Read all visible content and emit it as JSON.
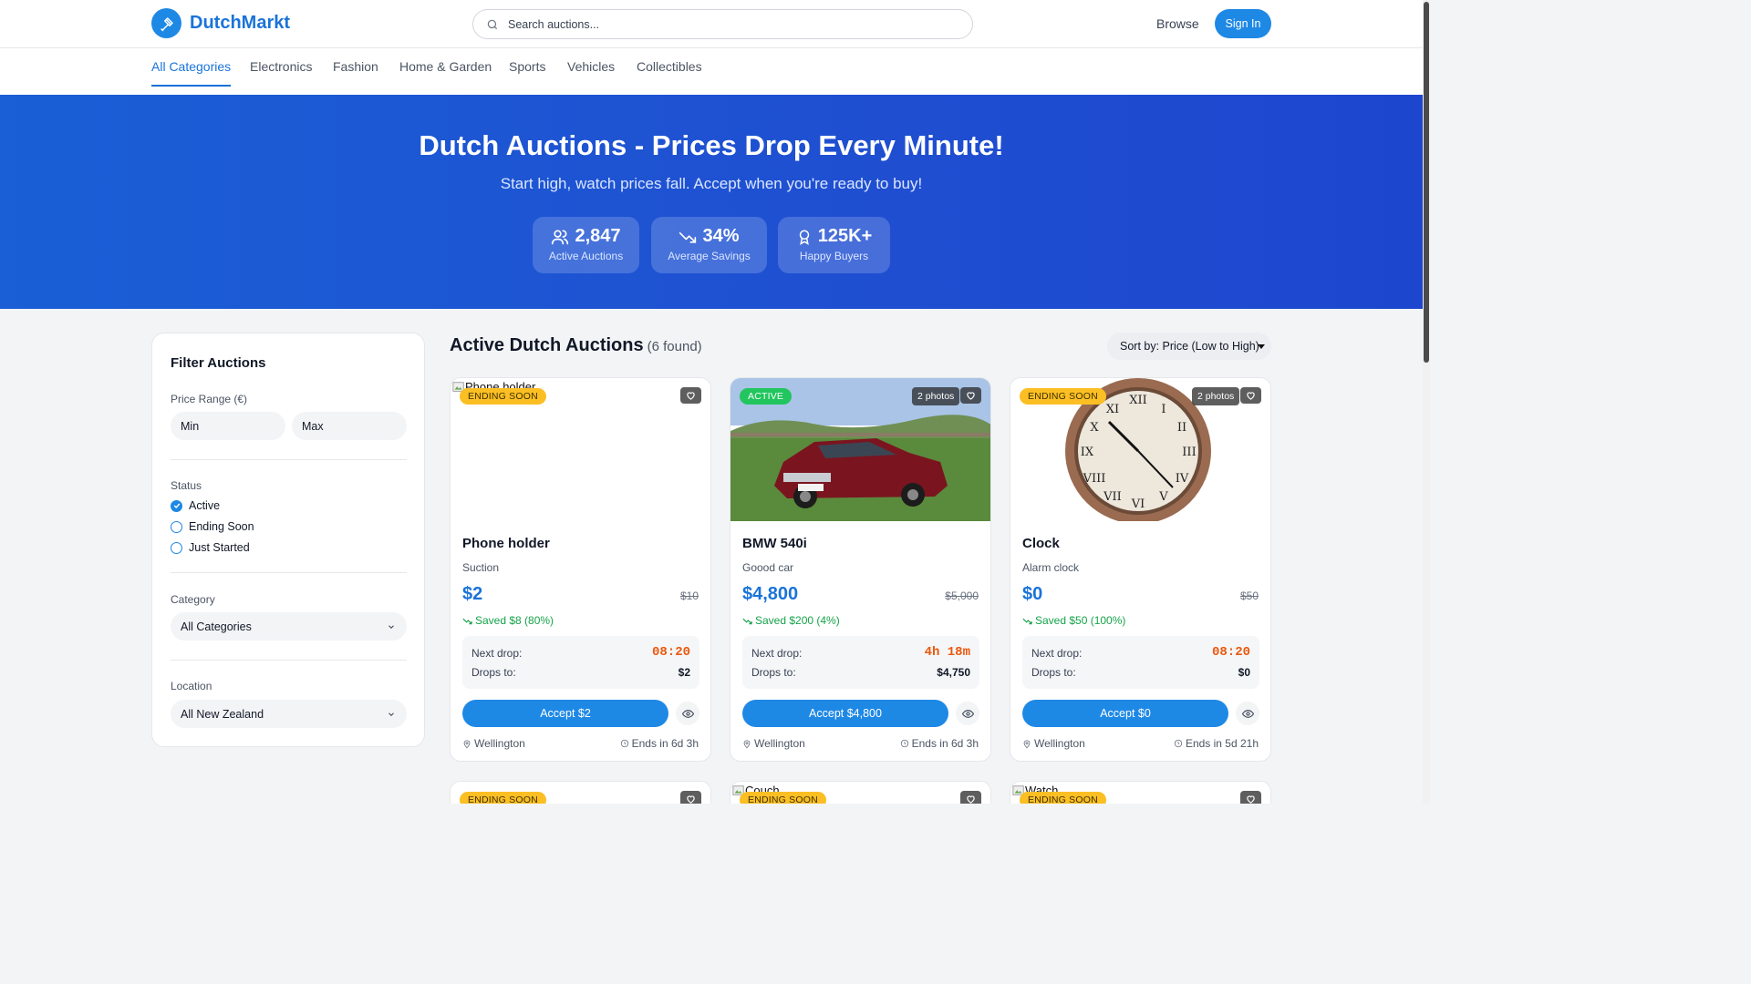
{
  "header": {
    "brand": "DutchMarkt",
    "search_placeholder": "Search auctions...",
    "browse": "Browse",
    "sign_in": "Sign In"
  },
  "categories": [
    "All Categories",
    "Electronics",
    "Fashion",
    "Home & Garden",
    "Sports",
    "Vehicles",
    "Collectibles"
  ],
  "hero": {
    "title": "Dutch Auctions - Prices Drop Every Minute!",
    "subtitle": "Start high, watch prices fall. Accept when you're ready to buy!",
    "stats": [
      {
        "value": "2,847",
        "label": "Active Auctions",
        "icon": "users-icon"
      },
      {
        "value": "34%",
        "label": "Average Savings",
        "icon": "trending-down-icon"
      },
      {
        "value": "125K+",
        "label": "Happy Buyers",
        "icon": "award-icon"
      }
    ]
  },
  "filters": {
    "title": "Filter Auctions",
    "price_label": "Price Range (€)",
    "min_placeholder": "Min",
    "max_placeholder": "Max",
    "status_label": "Status",
    "status_options": [
      {
        "label": "Active",
        "checked": true
      },
      {
        "label": "Ending Soon",
        "checked": false
      },
      {
        "label": "Just Started",
        "checked": false
      }
    ],
    "category_label": "Category",
    "category_value": "All Categories",
    "location_label": "Location",
    "location_value": "All New Zealand"
  },
  "listing": {
    "heading": "Active Dutch Auctions",
    "count": "(6 found)",
    "sort": "Sort by: Price (Low to High)"
  },
  "auctions": [
    {
      "title": "Phone holder",
      "alt": "Phone holder",
      "badge": "ENDING SOON",
      "photos": "",
      "desc": "Suction",
      "price": "$2",
      "original": "$10",
      "saved": "Saved $8 (80%)",
      "next_drop_label": "Next drop:",
      "timer": "08:20",
      "drops_to_label": "Drops to:",
      "drops_to": "$2",
      "accept": "Accept $2",
      "location": "Wellington",
      "ends": "Ends in 6d 3h"
    },
    {
      "title": "BMW 540i",
      "alt": "",
      "badge": "ACTIVE",
      "photos": "2 photos",
      "desc": "Goood car",
      "price": "$4,800",
      "original": "$5,000",
      "saved": "Saved $200 (4%)",
      "next_drop_label": "Next drop:",
      "timer": "4h 18m",
      "drops_to_label": "Drops to:",
      "drops_to": "$4,750",
      "accept": "Accept $4,800",
      "location": "Wellington",
      "ends": "Ends in 6d 3h"
    },
    {
      "title": "Clock",
      "alt": "",
      "badge": "ENDING SOON",
      "photos": "2 photos",
      "desc": "Alarm clock",
      "price": "$0",
      "original": "$50",
      "saved": "Saved $50 (100%)",
      "next_drop_label": "Next drop:",
      "timer": "08:20",
      "drops_to_label": "Drops to:",
      "drops_to": "$0",
      "accept": "Accept $0",
      "location": "Wellington",
      "ends": "Ends in 5d 21h"
    }
  ],
  "auctions_row2": [
    {
      "alt": "",
      "badge": "ENDING SOON"
    },
    {
      "alt": "Couch",
      "badge": "ENDING SOON"
    },
    {
      "alt": "Watch",
      "badge": "ENDING SOON"
    }
  ],
  "colors": {
    "primary": "#1e88e5",
    "brand_text": "#1a73d9",
    "hero": "#1f4fd1",
    "ending_soon": "#fbbf24",
    "active": "#22c55e",
    "timer": "#ea580c",
    "saved": "#16a34a"
  }
}
